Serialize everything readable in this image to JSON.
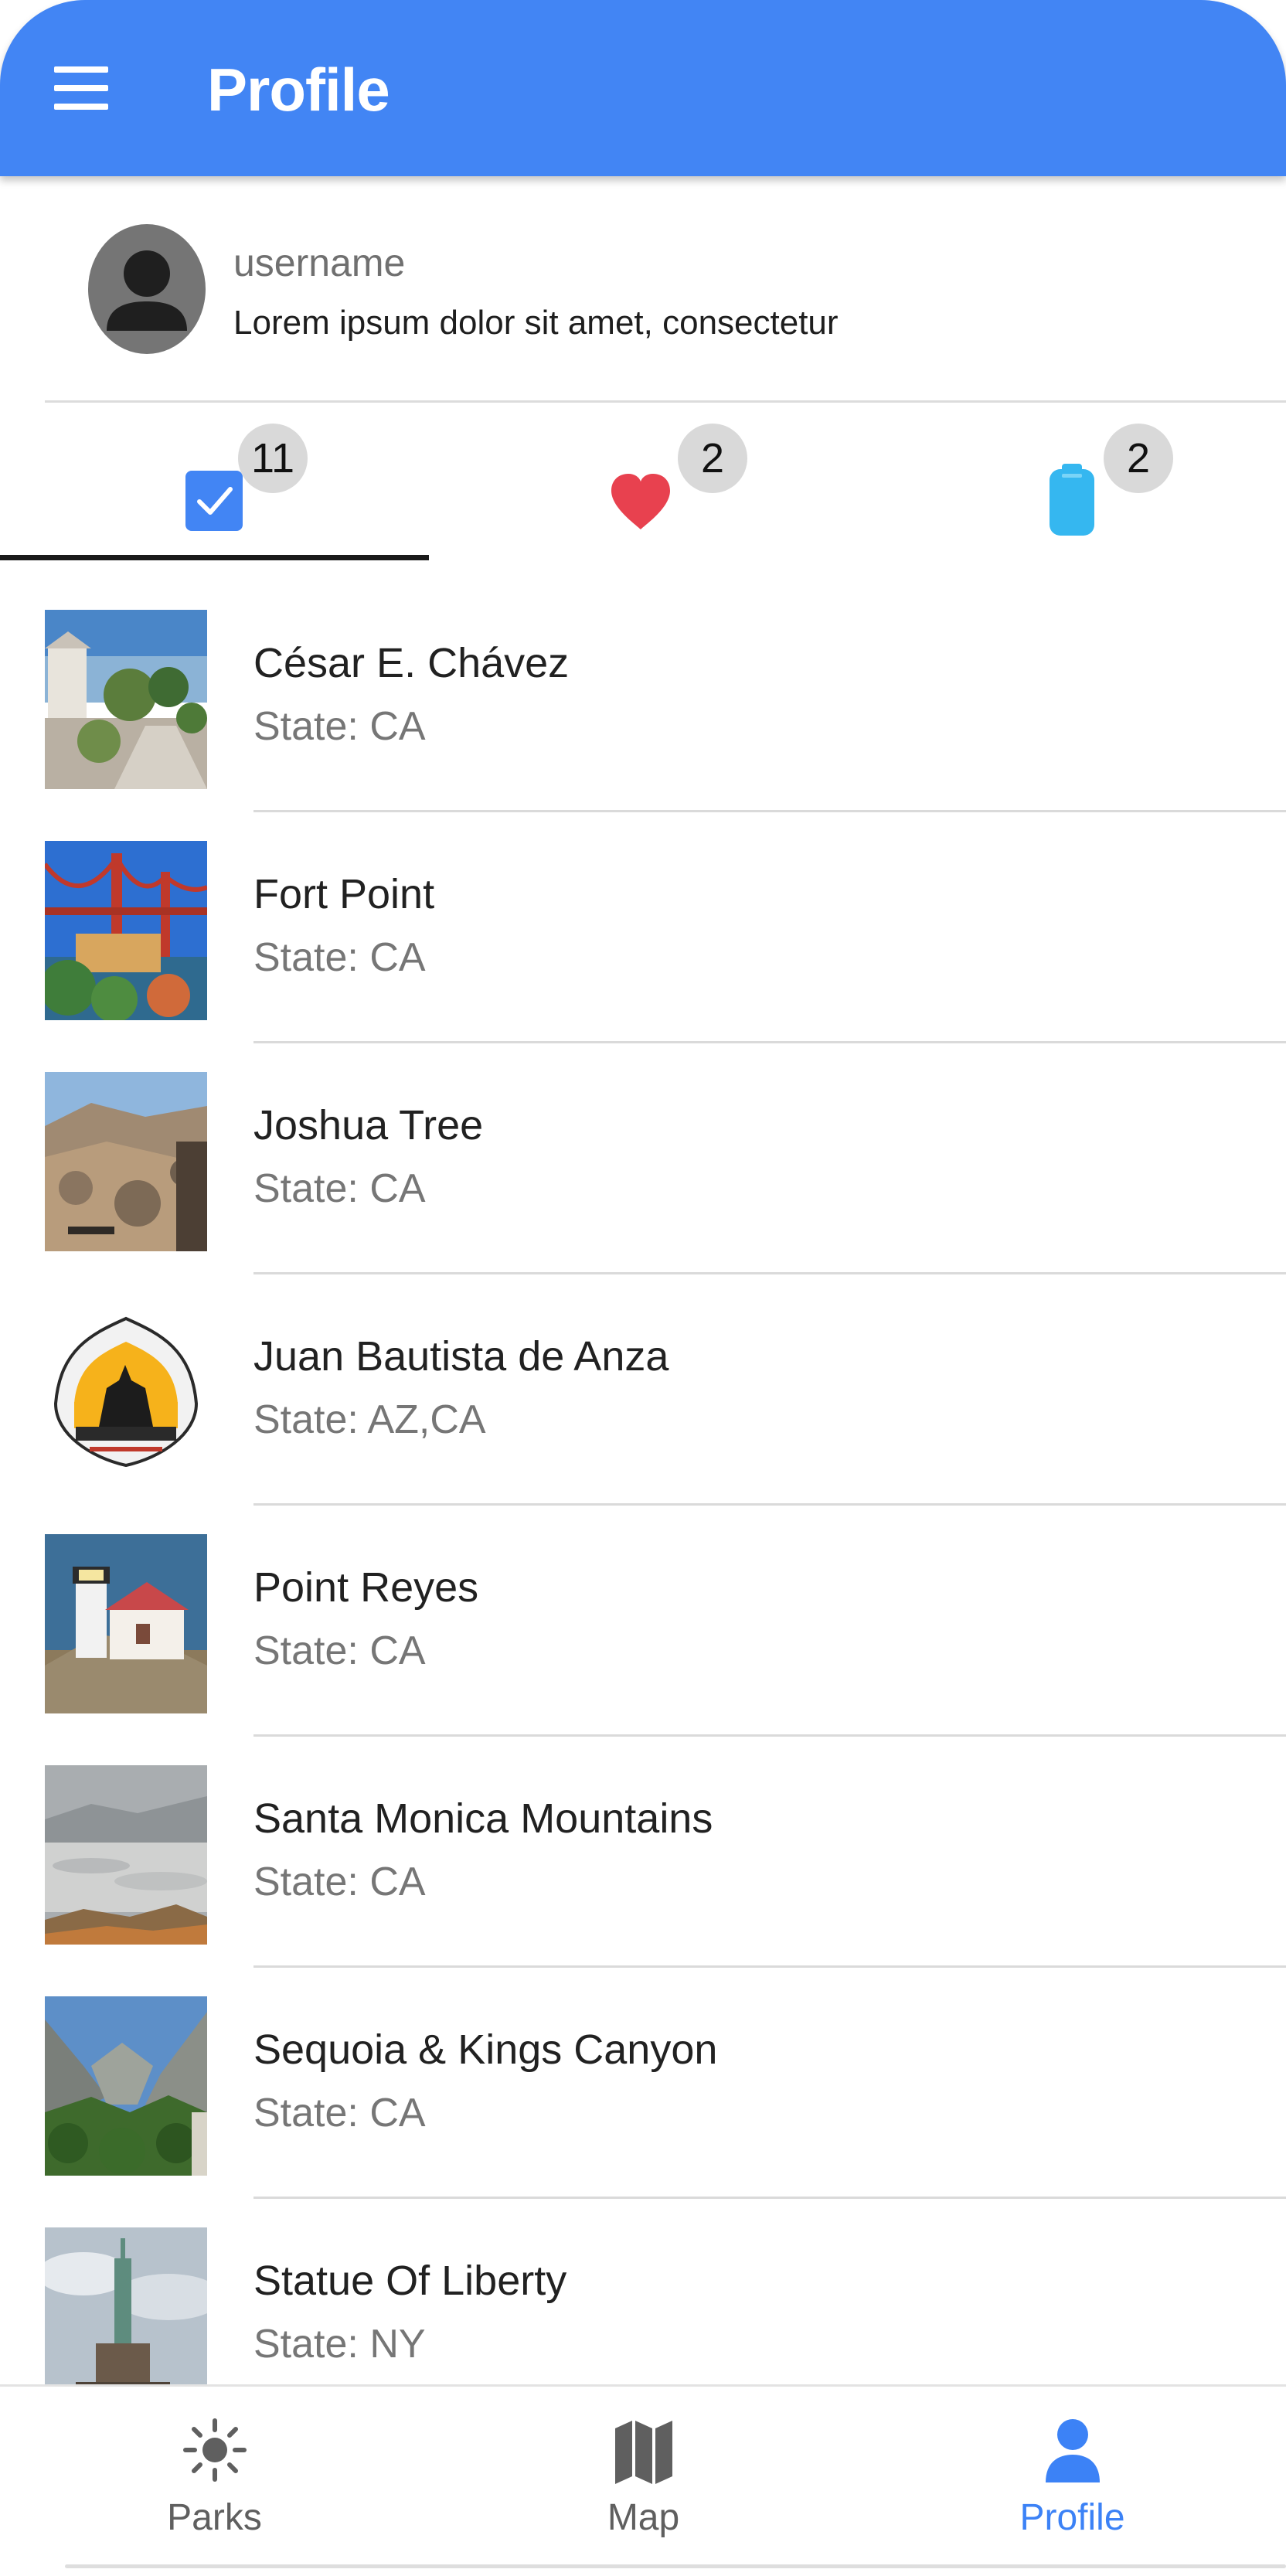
{
  "app_bar": {
    "title": "Profile",
    "menu_icon": "menu-icon",
    "color": "#4285f4"
  },
  "profile": {
    "username": "username",
    "bio": "Lorem ipsum dolor sit amet, consectetur",
    "avatar_icon": "person-icon"
  },
  "tabs": [
    {
      "icon": "checkbox-icon",
      "count": "11",
      "selected": true,
      "color": "#4285f4"
    },
    {
      "icon": "heart-icon",
      "count": "2",
      "selected": false,
      "color": "#e8414f"
    },
    {
      "icon": "battery-icon",
      "count": "2",
      "selected": false,
      "color": "#35b7f0"
    }
  ],
  "parks": [
    {
      "name": "César E. Chávez",
      "state": "State: CA"
    },
    {
      "name": "Fort Point",
      "state": "State: CA"
    },
    {
      "name": "Joshua Tree",
      "state": "State: CA"
    },
    {
      "name": "Juan Bautista de Anza",
      "state": "State: AZ,CA"
    },
    {
      "name": "Point Reyes",
      "state": "State: CA"
    },
    {
      "name": "Santa Monica Mountains",
      "state": "State: CA"
    },
    {
      "name": "Sequoia & Kings Canyon",
      "state": "State: CA"
    },
    {
      "name": "Statue Of Liberty",
      "state": "State: NY"
    }
  ],
  "bottom_nav": [
    {
      "label": "Parks",
      "icon": "sun-icon",
      "active": false
    },
    {
      "label": "Map",
      "icon": "map-icon",
      "active": false
    },
    {
      "label": "Profile",
      "icon": "person-icon",
      "active": true
    }
  ],
  "colors": {
    "nav_active": "#3c82f6",
    "nav_inactive": "#5f5f5f"
  }
}
